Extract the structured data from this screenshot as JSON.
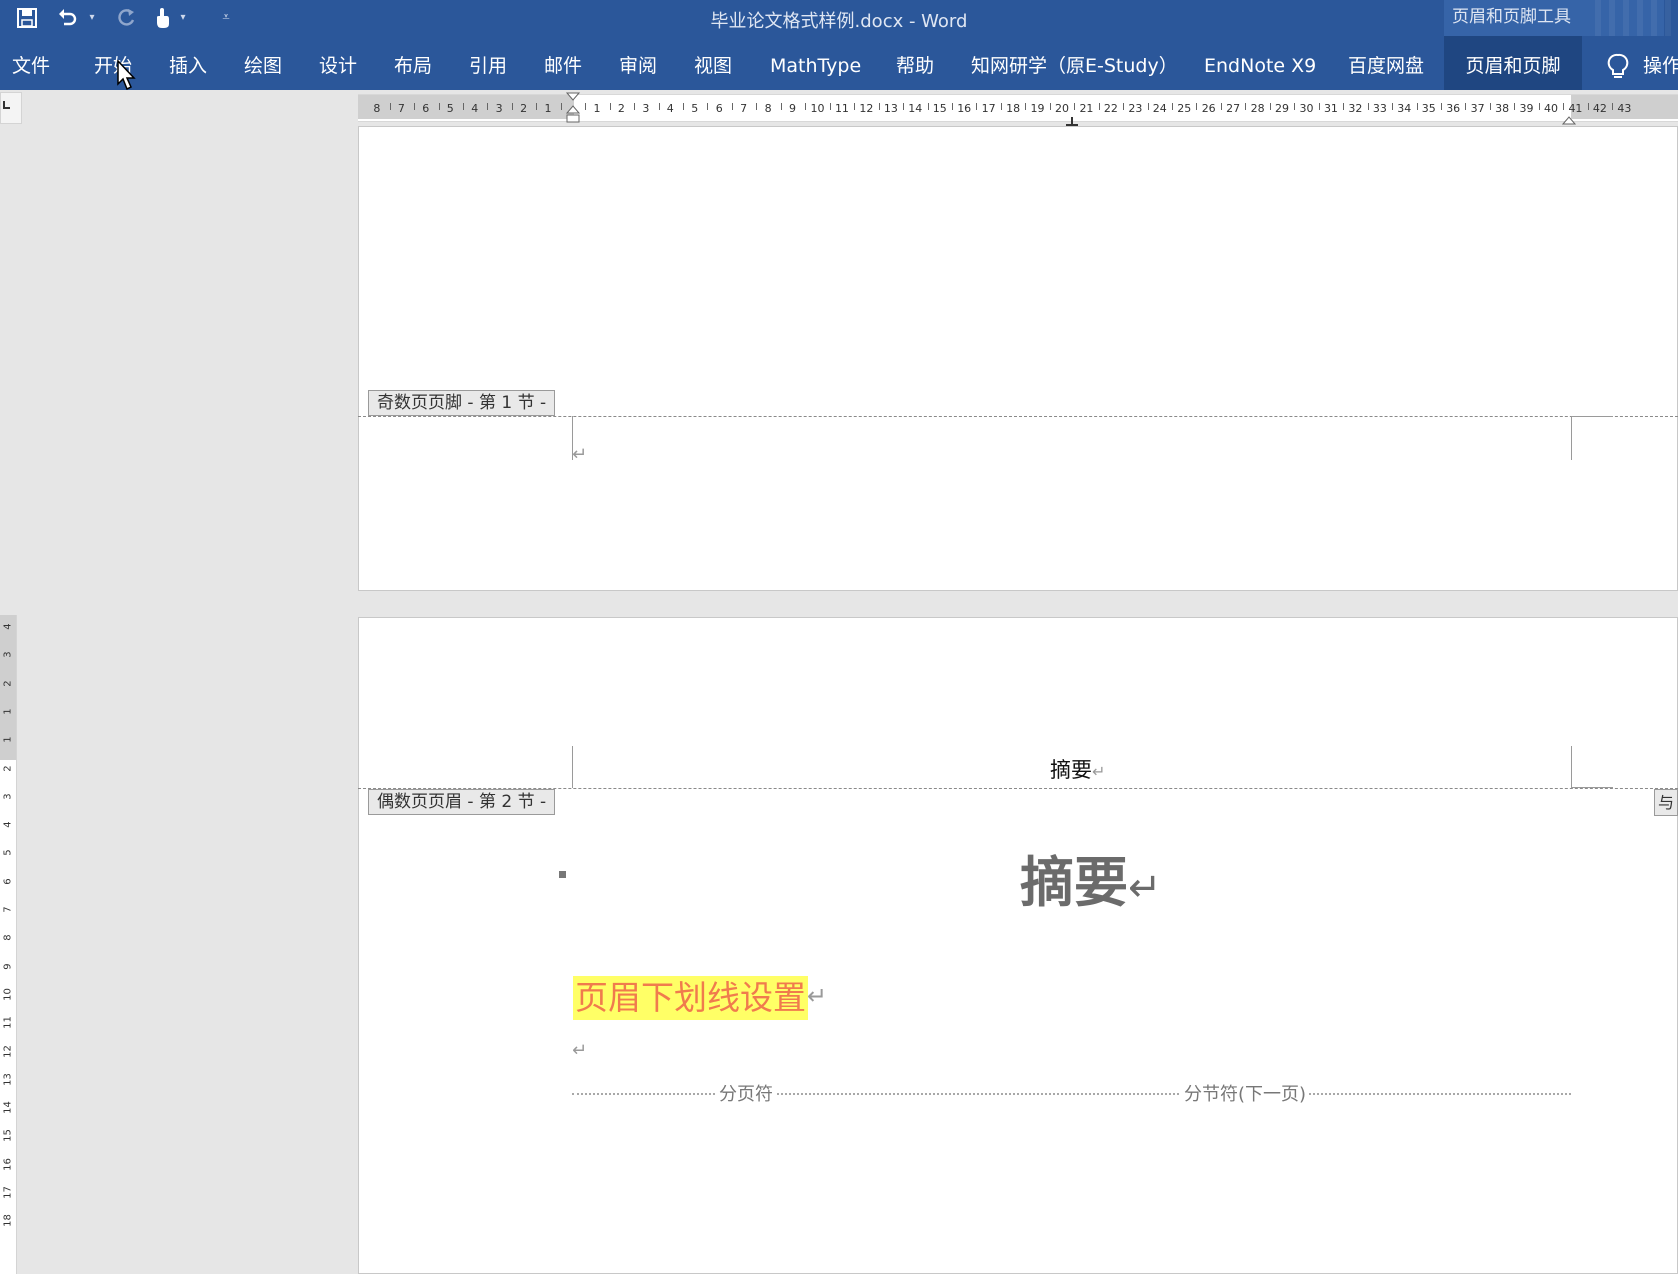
{
  "window": {
    "title": "毕业论文格式样例.docx  -  Word",
    "contextual_tools_label": "页眉和页脚工具"
  },
  "quick_access": {
    "icons": [
      "save-icon",
      "undo-icon",
      "redo-icon",
      "touch-mode-icon",
      "customize-icon"
    ]
  },
  "ribbon": {
    "tabs": [
      "文件",
      "开始",
      "插入",
      "绘图",
      "设计",
      "布局",
      "引用",
      "邮件",
      "审阅",
      "视图",
      "MathType",
      "帮助",
      "知网研学（原E-Study）",
      "EndNote X9",
      "百度网盘",
      "页眉和页脚"
    ],
    "active_tab": "页眉和页脚",
    "tell_me": "操作"
  },
  "ruler": {
    "left_numbers": [
      "8",
      "7",
      "6",
      "5",
      "4",
      "3",
      "2",
      "1"
    ],
    "right_numbers": [
      "1",
      "2",
      "3",
      "4",
      "5",
      "6",
      "7",
      "8",
      "9",
      "10",
      "11",
      "12",
      "13",
      "14",
      "15",
      "16",
      "17",
      "18",
      "19",
      "20",
      "21",
      "22",
      "23",
      "24",
      "25",
      "26",
      "27",
      "28",
      "29",
      "30",
      "31",
      "32",
      "33",
      "34",
      "35",
      "36",
      "37",
      "38",
      "39",
      "40",
      "41",
      "42",
      "43"
    ],
    "vertical_numbers": [
      "4",
      "3",
      "2",
      "1",
      "1",
      "2",
      "3",
      "4",
      "5",
      "6",
      "7",
      "8",
      "9",
      "10",
      "11",
      "12",
      "13",
      "14",
      "15",
      "16",
      "17",
      "18"
    ]
  },
  "document": {
    "page1": {
      "footer_tag": "奇数页页脚 - 第 1 节 -",
      "footer_para_mark": "↵"
    },
    "page2": {
      "header_tag": "偶数页页眉 - 第 2 节 -",
      "header_text": "摘要",
      "header_para_mark": "↵",
      "right_tag": "与",
      "heading": "摘要",
      "heading_mark": "↵",
      "highlighted_text": "页眉下划线设置",
      "highlighted_mark": "↵",
      "empty_para_mark": "↵",
      "page_break_label": "分页符",
      "section_break_label": "分节符(下一页)"
    }
  },
  "colors": {
    "ribbon_blue": "#2b579a",
    "highlight": "#ffff66",
    "highlight_text": "#f07b4d"
  }
}
